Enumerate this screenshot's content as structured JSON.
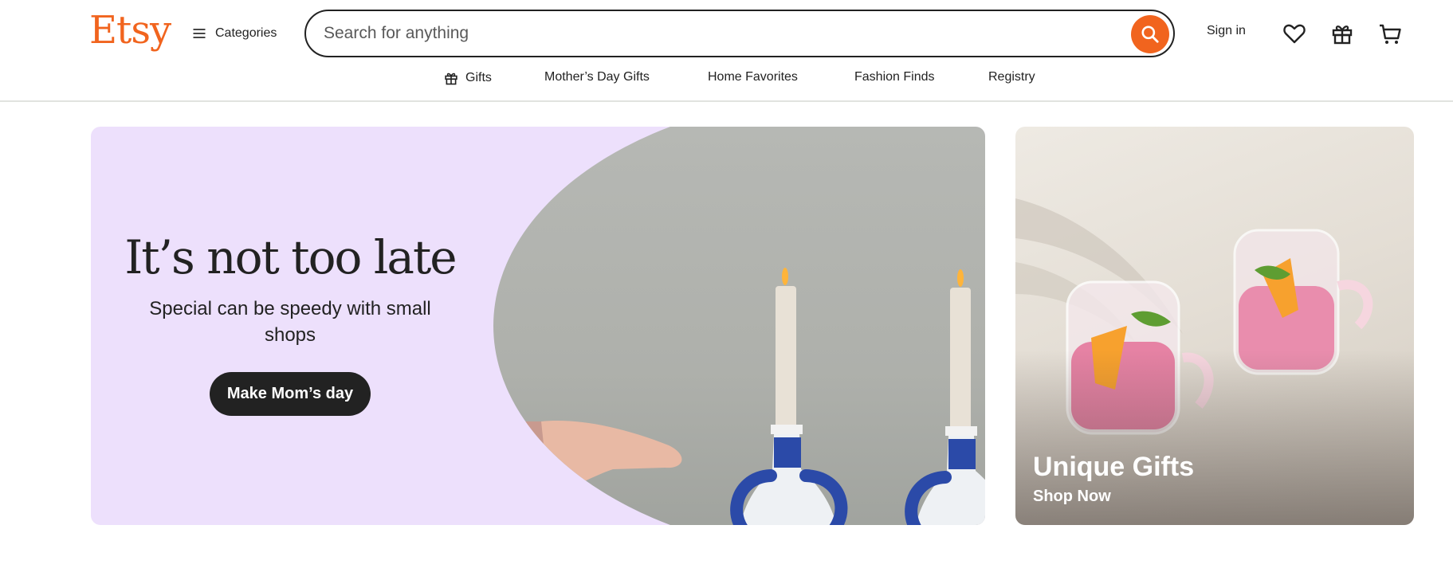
{
  "header": {
    "logo": "Etsy",
    "categories_label": "Categories",
    "search_placeholder": "Search for anything",
    "signin_label": "Sign in"
  },
  "nav": {
    "items": [
      "Gifts",
      "Mother’s Day Gifts",
      "Home Favorites",
      "Fashion Finds",
      "Registry"
    ]
  },
  "hero": {
    "title": "It’s not too late",
    "subtitle": "Special can be speedy with small shops",
    "button_label": "Make Mom’s day"
  },
  "side_card": {
    "title": "Unique Gifts",
    "link": "Shop Now"
  },
  "colors": {
    "brand": "#f1641e",
    "hero_bg": "#ede0fc",
    "text": "#222222"
  }
}
